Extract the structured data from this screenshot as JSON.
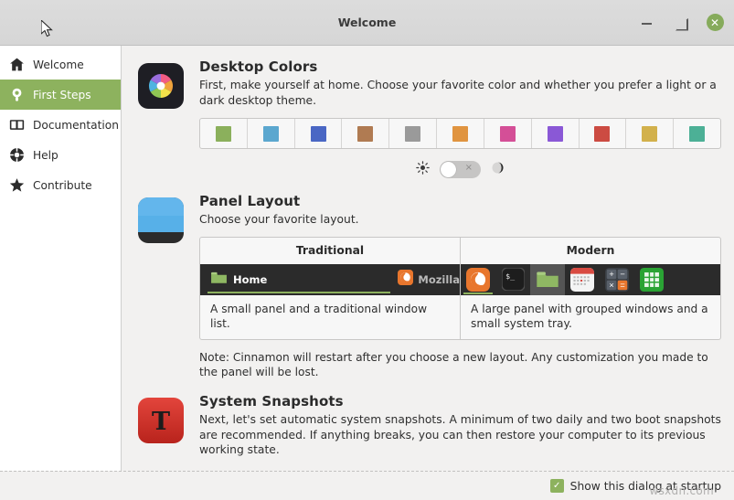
{
  "window": {
    "title": "Welcome",
    "controls": {
      "minimize": "minimize",
      "maximize": "restore",
      "close": "✕"
    }
  },
  "sidebar": {
    "items": [
      {
        "label": "Welcome",
        "icon": "home-icon",
        "active": false
      },
      {
        "label": "First Steps",
        "icon": "lightbulb-icon",
        "active": true
      },
      {
        "label": "Documentation",
        "icon": "book-icon",
        "active": false
      },
      {
        "label": "Help",
        "icon": "lifering-icon",
        "active": false
      },
      {
        "label": "Contribute",
        "icon": "star-icon",
        "active": false
      }
    ]
  },
  "sections": {
    "desktop_colors": {
      "icon": "color-wheel-icon",
      "title": "Desktop Colors",
      "description": "First, make yourself at home. Choose your favorite color and whether you prefer a light or a dark desktop theme.",
      "swatches": [
        {
          "name": "green",
          "hex": "#8bb05c"
        },
        {
          "name": "blue",
          "hex": "#5ba7cf"
        },
        {
          "name": "indigo",
          "hex": "#4a67c4"
        },
        {
          "name": "brown",
          "hex": "#b07b52"
        },
        {
          "name": "grey",
          "hex": "#9a9a9a"
        },
        {
          "name": "orange",
          "hex": "#e09440"
        },
        {
          "name": "pink",
          "hex": "#d44f97"
        },
        {
          "name": "purple",
          "hex": "#8a58d6"
        },
        {
          "name": "red",
          "hex": "#cc4b42"
        },
        {
          "name": "yellow",
          "hex": "#d2b14c"
        },
        {
          "name": "teal",
          "hex": "#4cb096"
        }
      ],
      "theme_toggle": {
        "light_icon": "sun-icon",
        "dark_icon": "moon-icon",
        "state_label": "×",
        "state": "off"
      }
    },
    "panel_layout": {
      "icon": "panel-icon",
      "title": "Panel Layout",
      "description": "Choose your favorite layout.",
      "options": [
        {
          "name": "Traditional",
          "description": "A small panel and a traditional window list.",
          "preview_items": [
            "Home",
            "Mozilla"
          ]
        },
        {
          "name": "Modern",
          "description": "A large panel with grouped windows and a small system tray.",
          "preview_items": [
            "firefox-icon",
            "terminal-icon",
            "files-icon",
            "calendar-icon",
            "calculator-icon",
            "spreadsheet-icon"
          ]
        }
      ],
      "note": "Note: Cinnamon will restart after you choose a new layout. Any customization you made to the panel will be lost."
    },
    "system_snapshots": {
      "icon": "timeshift-icon",
      "title": "System Snapshots",
      "description": "Next, let's set automatic system snapshots. A minimum of two daily and two boot snapshots are recommended. If anything breaks, you can then restore your computer to its previous working state."
    }
  },
  "bottom_bar": {
    "checkbox_label": "Show this dialog at startup",
    "checkbox_checked": true,
    "check_glyph": "✓",
    "watermark": "wsxdn.com"
  },
  "theme": {
    "accent": "#8db25e",
    "sidebar_bg": "#ffffff",
    "content_bg": "#f2f1f0"
  }
}
